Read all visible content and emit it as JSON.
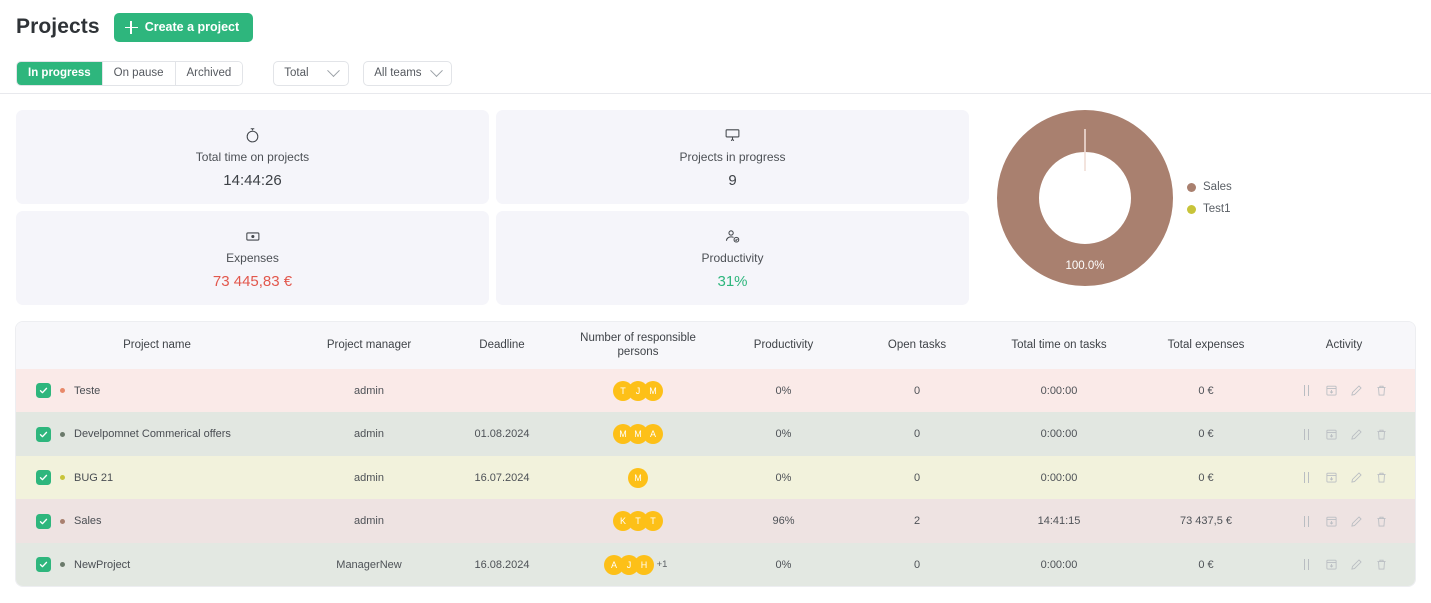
{
  "header": {
    "title": "Projects",
    "create_button": "Create a project"
  },
  "filters": {
    "segments": [
      {
        "label": "In progress",
        "active": true
      },
      {
        "label": "On pause",
        "active": false
      },
      {
        "label": "Archived",
        "active": false
      }
    ],
    "period_select": "Total",
    "team_select": "All teams"
  },
  "stats": [
    {
      "icon": "stopwatch-icon",
      "label": "Total time on projects",
      "value": "14:44:26",
      "tone": "default"
    },
    {
      "icon": "projector-icon",
      "label": "Projects in progress",
      "value": "9",
      "tone": "default"
    },
    {
      "icon": "money-icon",
      "label": "Expenses",
      "value": "73 445,83 €",
      "tone": "red"
    },
    {
      "icon": "productivity-icon",
      "label": "Productivity",
      "value": "31%",
      "tone": "green"
    }
  ],
  "chart_data": {
    "type": "pie",
    "title": "",
    "variant": "donut",
    "center_label": "100.0%",
    "labels": [
      "Sales",
      "Test1"
    ],
    "values": [
      100.0,
      0.0
    ],
    "colors": [
      "#a9806f",
      "#c8c43a"
    ],
    "legend_position": "right",
    "slice_label": "100.0%"
  },
  "table": {
    "columns": [
      "Project name",
      "Project manager",
      "Deadline",
      "Number of responsible persons",
      "Productivity",
      "Open tasks",
      "Total time on tasks",
      "Total expenses",
      "Activity"
    ],
    "rows": [
      {
        "checked": true,
        "dot_color": "#e8896a",
        "name": "Teste",
        "manager": "admin",
        "deadline": "",
        "avatars": [
          "T",
          "J",
          "M"
        ],
        "extra_avatars": "",
        "productivity": "0%",
        "open_tasks": "0",
        "total_time": "0:00:00",
        "total_expenses": "0 €",
        "row_color": "#faeae8"
      },
      {
        "checked": true,
        "dot_color": "#6b7a6b",
        "name": "Develpomnet Commerical offers",
        "manager": "admin",
        "deadline": "01.08.2024",
        "avatars": [
          "M",
          "M",
          "A"
        ],
        "extra_avatars": "",
        "productivity": "0%",
        "open_tasks": "0",
        "total_time": "0:00:00",
        "total_expenses": "0 €",
        "row_color": "#e2e7e1"
      },
      {
        "checked": true,
        "dot_color": "#c8c43a",
        "name": "BUG 21",
        "manager": "admin",
        "deadline": "16.07.2024",
        "avatars": [
          "M"
        ],
        "extra_avatars": "",
        "productivity": "0%",
        "open_tasks": "0",
        "total_time": "0:00:00",
        "total_expenses": "0 €",
        "row_color": "#f2f2dc"
      },
      {
        "checked": true,
        "dot_color": "#a9806f",
        "name": "Sales",
        "manager": "admin",
        "deadline": "",
        "avatars": [
          "K",
          "T",
          "T"
        ],
        "extra_avatars": "",
        "productivity": "96%",
        "open_tasks": "2",
        "total_time": "14:41:15",
        "total_expenses": "73 437,5 €",
        "row_color": "#eee3e2"
      },
      {
        "checked": true,
        "dot_color": "#6b7a6b",
        "name": "NewProject",
        "manager": "ManagerNew",
        "deadline": "16.08.2024",
        "avatars": [
          "A",
          "J",
          "H"
        ],
        "extra_avatars": "+1",
        "productivity": "0%",
        "open_tasks": "0",
        "total_time": "0:00:00",
        "total_expenses": "0 €",
        "row_color": "#e3e8e2"
      }
    ],
    "action_icons": [
      "pause-icon",
      "archive-icon",
      "edit-icon",
      "delete-icon"
    ]
  },
  "colors": {
    "accent": "#2eb67d",
    "danger": "#e2574c",
    "avatar": "#fdc018"
  }
}
